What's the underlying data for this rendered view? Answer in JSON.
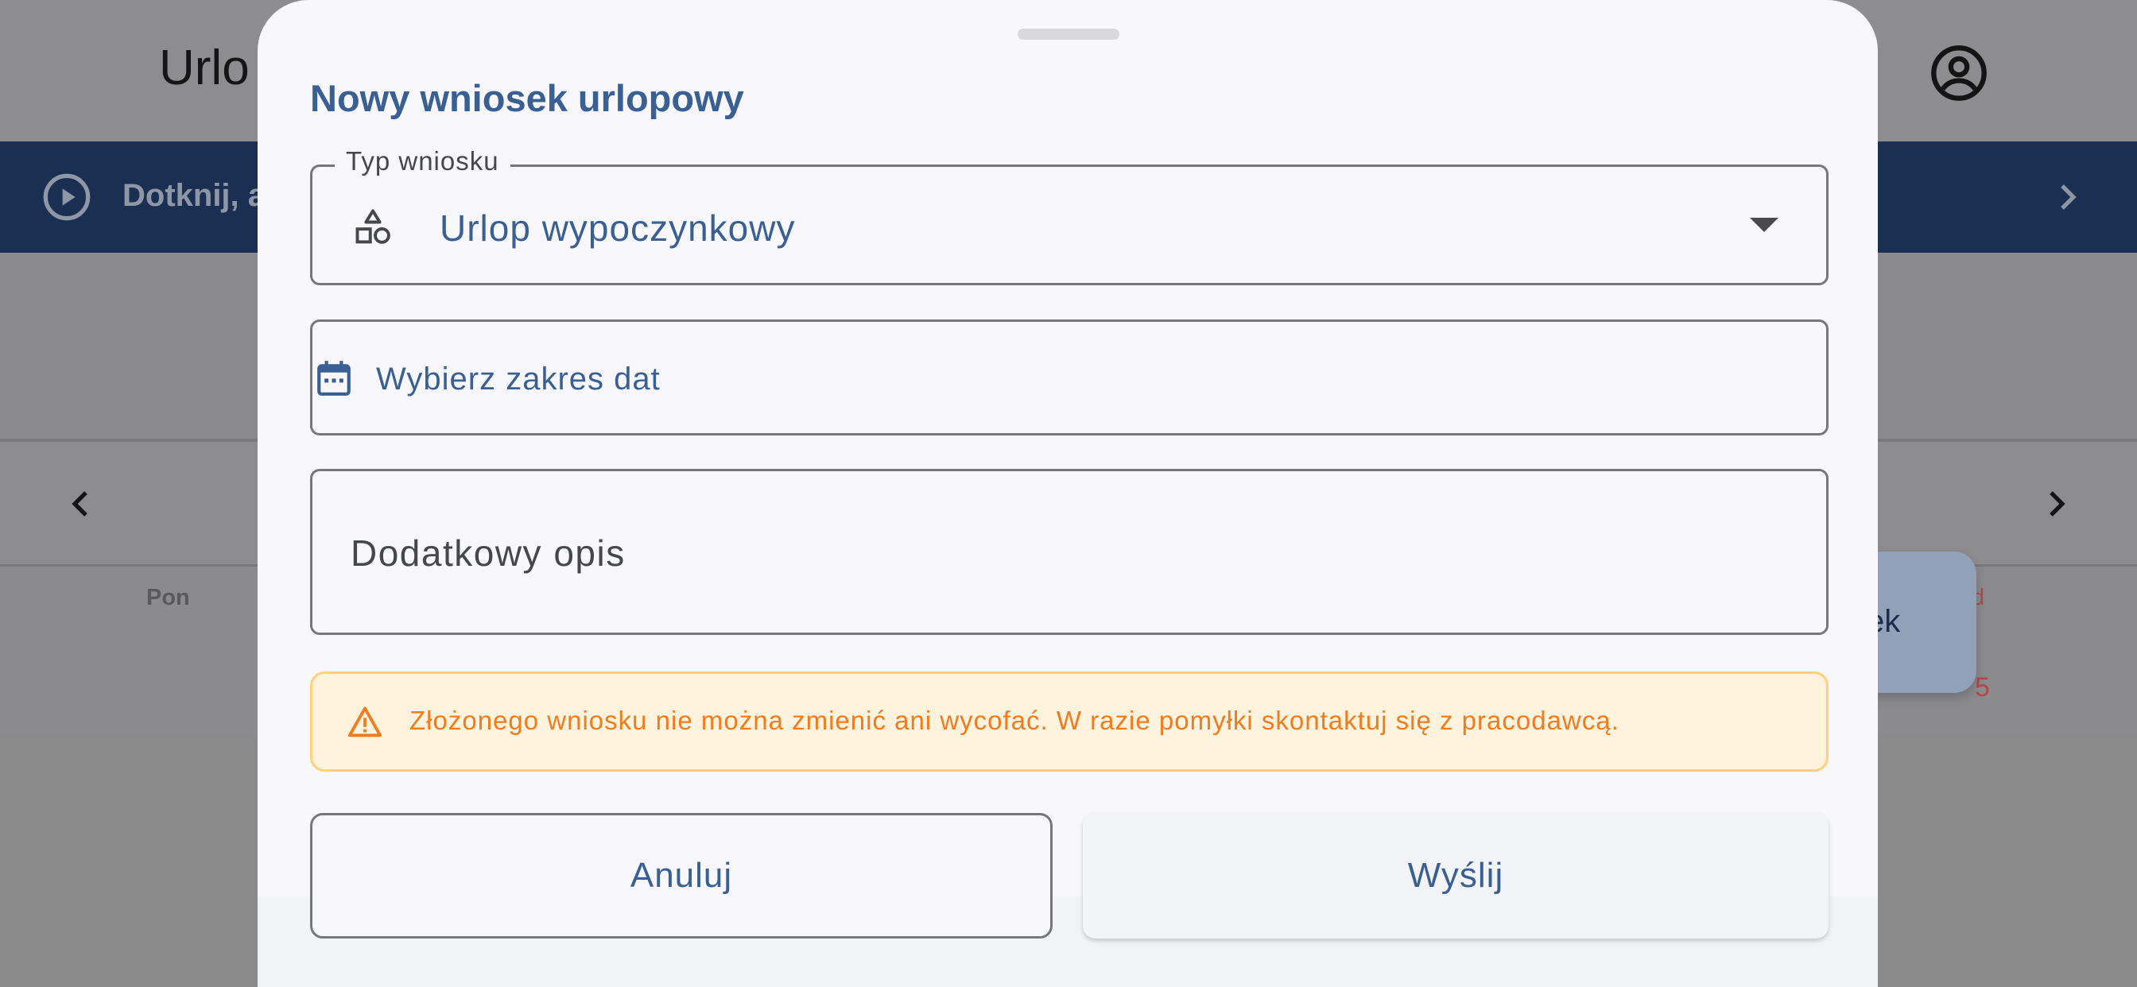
{
  "background_app": {
    "title": "Urlo",
    "banner_text": "Dotknij, a",
    "weekday_first": "Pon",
    "weekday_last": "d",
    "day_number_last": "5",
    "fab_label": "sek"
  },
  "sheet": {
    "title": "Nowy wniosek urlopowy",
    "type_field": {
      "label": "Typ wniosku",
      "value": "Urlop wypoczynkowy",
      "icon": "category-shapes-icon"
    },
    "date_field": {
      "label": "Wybierz zakres dat",
      "icon": "calendar-icon"
    },
    "description_field": {
      "placeholder": "Dodatkowy opis"
    },
    "warning": {
      "text": "Złożonego wniosku nie można zmienić ani wycofać. W razie pomyłki skontaktuj się z pracodawcą.",
      "icon": "warning-icon"
    },
    "buttons": {
      "cancel": "Anuluj",
      "submit": "Wyślij"
    }
  },
  "colors": {
    "accent": "#3a5f93",
    "banner": "#1b2f52",
    "warning_text": "#ef7c1f",
    "warning_bg": "#fff3de",
    "warning_border": "#ffd27a",
    "scrim": "#8b8b8e"
  }
}
